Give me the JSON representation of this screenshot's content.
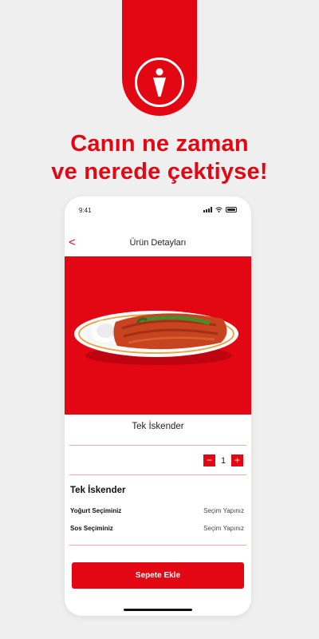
{
  "headline": {
    "line1": "Canın ne zaman",
    "line2": "ve nerede çektiyse!"
  },
  "status_bar": {
    "time": "9:41"
  },
  "nav": {
    "back_icon": "<",
    "title": "Ürün Detayları"
  },
  "product": {
    "name": "Tek İskender",
    "quantity": "1",
    "minus": "−",
    "plus": "+"
  },
  "options": {
    "section_title": "Tek İskender",
    "items": [
      {
        "label": "Yoğurt Seçiminiz",
        "value": "Seçim Yapınız"
      },
      {
        "label": "Sos Seçiminiz",
        "value": "Seçim Yapınız"
      }
    ]
  },
  "cta": {
    "label": "Sepete Ekle"
  },
  "colors": {
    "brand": "#e30613",
    "background": "#efefef"
  }
}
